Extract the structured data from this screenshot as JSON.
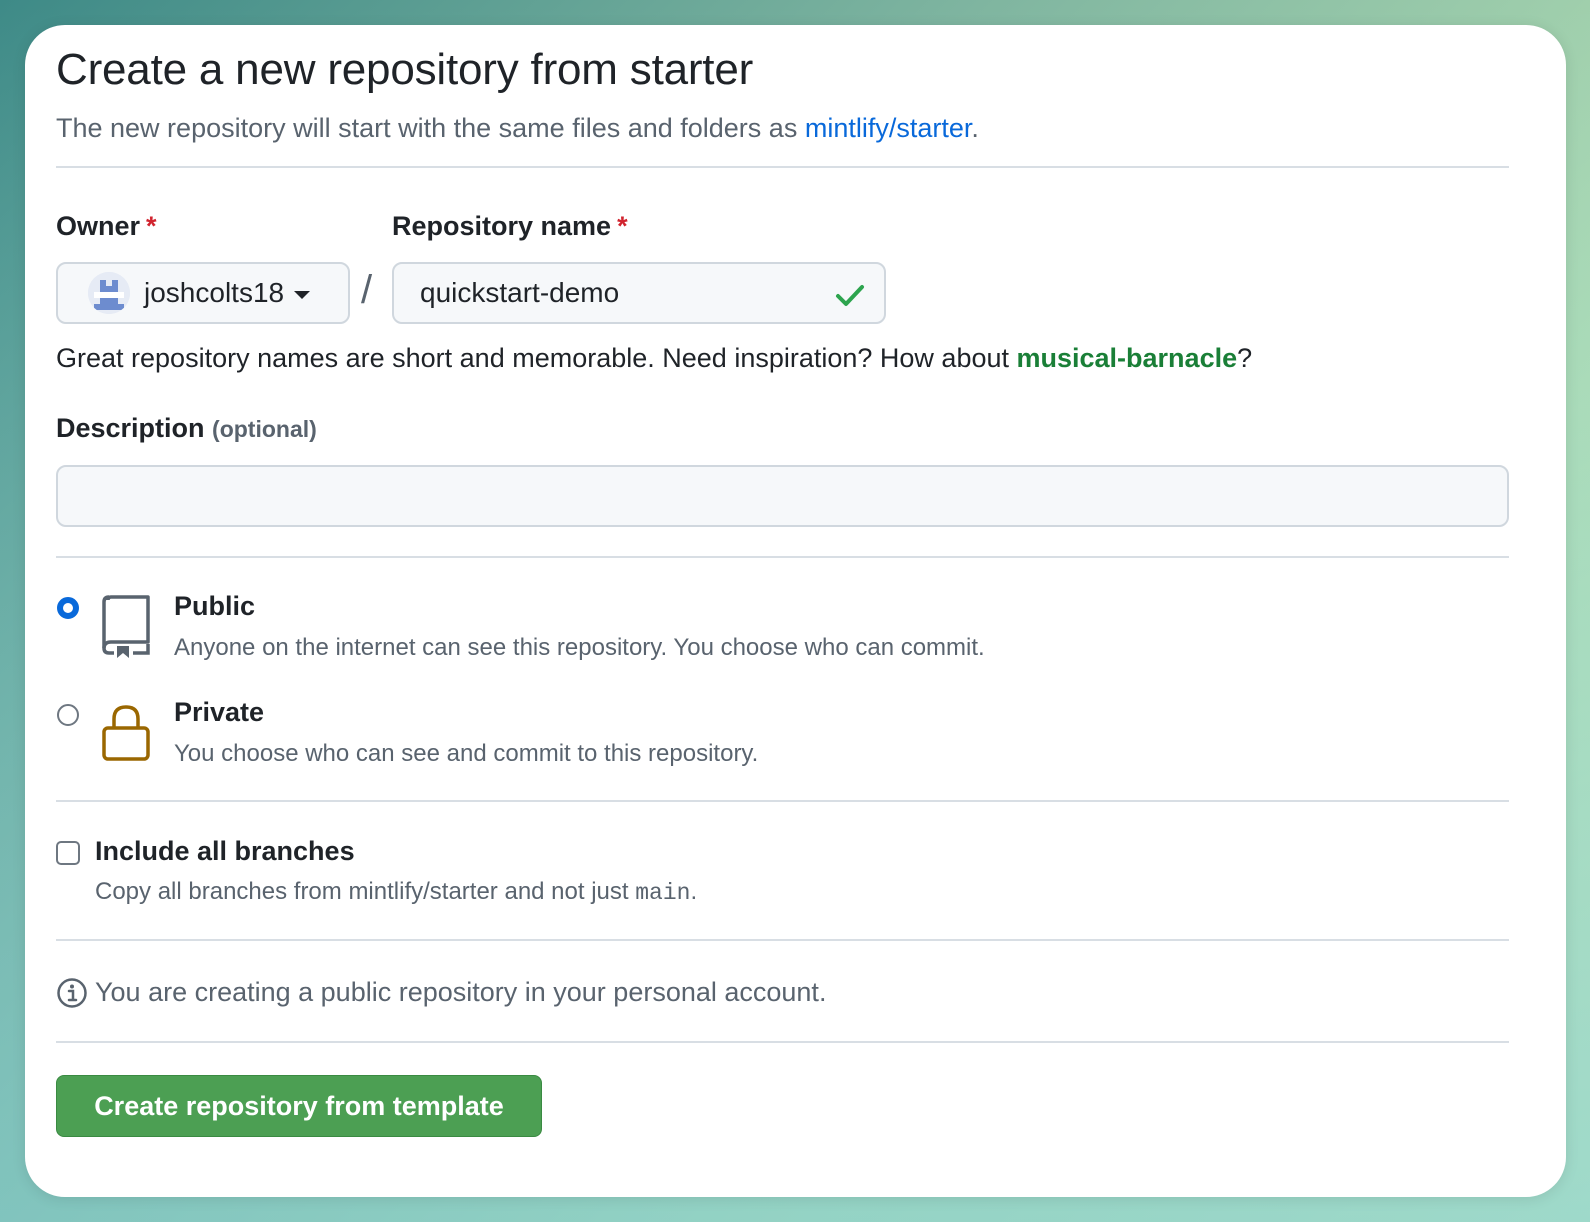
{
  "header": {
    "title": "Create a new repository from starter",
    "subtitle_prefix": "The new repository will start with the same files and folders as ",
    "template_link": "mintlify/starter",
    "subtitle_suffix": "."
  },
  "owner": {
    "label": "Owner",
    "required_mark": "*",
    "value": "joshcolts18"
  },
  "repo": {
    "label": "Repository name",
    "required_mark": "*",
    "value": "quickstart-demo"
  },
  "hint": {
    "prefix": "Great repository names are short and memorable. Need inspiration? How about ",
    "suggestion": "musical-barnacle",
    "suffix": "?"
  },
  "description": {
    "label": "Description",
    "optional_label": "(optional)",
    "value": ""
  },
  "visibility": {
    "public": {
      "title": "Public",
      "desc": "Anyone on the internet can see this repository. You choose who can commit.",
      "selected": true
    },
    "private": {
      "title": "Private",
      "desc": "You choose who can see and commit to this repository.",
      "selected": false
    }
  },
  "branches": {
    "title": "Include all branches",
    "desc_prefix": "Copy all branches from mintlify/starter and not just ",
    "desc_code": "main",
    "desc_suffix": ".",
    "checked": false
  },
  "info": {
    "text": "You are creating a public repository in your personal account."
  },
  "submit": {
    "label": "Create repository from template"
  },
  "colors": {
    "link_blue": "#0969da",
    "suggestion_green": "#1a7f37",
    "button_green": "#4c9f53",
    "required_red": "#d1242f",
    "lock_gold": "#9a6700"
  }
}
